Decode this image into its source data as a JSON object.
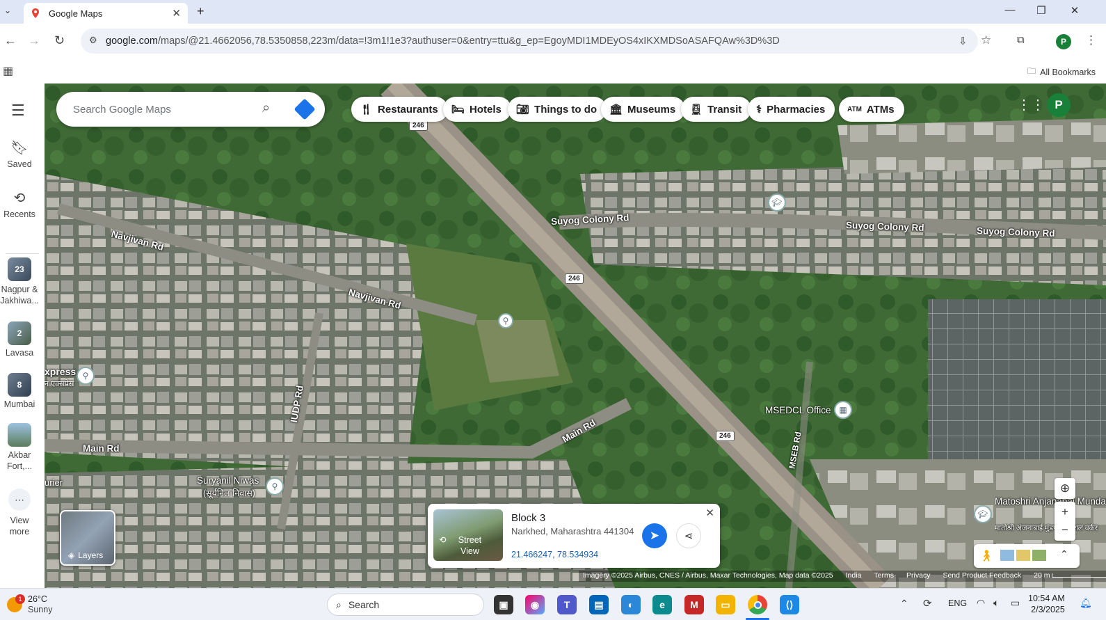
{
  "browser": {
    "tab_title": "Google Maps",
    "tab_close": "✕",
    "new_tab": "+",
    "url_host": "google.com",
    "url_path": "/maps/@21.4662056,78.5350858,223m/data=!3m1!1e3?authuser=0&entry=ttu&g_ep=EgoyMDI1MDEyOS4xIKXMDSoASAFQAw%3D%3D",
    "all_bookmarks": "All Bookmarks",
    "profile_initial": "P"
  },
  "rail": {
    "saved": "Saved",
    "recents": "Recents",
    "items": [
      {
        "count": "23",
        "label": "Nagpur & Jakhiwa..."
      },
      {
        "count": "2",
        "label": "Lavasa"
      },
      {
        "count": "8",
        "label": "Mumbai"
      },
      {
        "count": "",
        "label": "Akbar Fort,..."
      }
    ],
    "view_more": "View more"
  },
  "search": {
    "placeholder": "Search Google Maps"
  },
  "chips": [
    {
      "label": "Restaurants",
      "icon": "restaurant-icon"
    },
    {
      "label": "Hotels",
      "icon": "bed-icon"
    },
    {
      "label": "Things to do",
      "icon": "camera-icon"
    },
    {
      "label": "Museums",
      "icon": "museum-icon"
    },
    {
      "label": "Transit",
      "icon": "train-icon"
    },
    {
      "label": "Pharmacies",
      "icon": "pharmacy-icon"
    },
    {
      "label": "ATMs",
      "icon": "atm-icon"
    }
  ],
  "map_labels": {
    "suyog1": "Suyog Colony Rd",
    "suyog2": "Suyog Colony Rd",
    "suyog3": "Suyog Colony Rd",
    "navjivan1": "Navjivan Rd",
    "navjivan2": "Navjivan Rd",
    "main1": "Main Rd",
    "main2": "Main Rd",
    "iudp": "IUDP Rd",
    "mseb": "MSEB Rd",
    "express": "xpress",
    "express_sub": "न एक्सप्रेस",
    "urier": "urier",
    "suryanil": "Suryanil Niwas",
    "suryanil_sub": "(सूर्यनिल निवास)",
    "msedcl": "MSEDCL Office",
    "matoshri": "Matoshri Anjanabai Mundafale So",
    "matoshri_sub": "मातोश्री अंजनाबाई मुंडफळे सोशल वर्कर",
    "hw1": "246",
    "hw2": "246",
    "hw3": "246"
  },
  "card": {
    "title": "Block 3",
    "address": "Narkhed, Maharashtra 441304",
    "coords": "21.466247, 78.534934",
    "street_view": "Street View",
    "close": "✕"
  },
  "layers": "Layers",
  "attribution": {
    "imagery": "Imagery ©2025 Airbus, CNES / Airbus, Maxar Technologies, Map data ©2025",
    "india": "India",
    "terms": "Terms",
    "privacy": "Privacy",
    "feedback": "Send Product Feedback",
    "scale": "20 m"
  },
  "taskbar": {
    "weather_temp": "26°C",
    "weather_cond": "Sunny",
    "weather_badge": "1",
    "search": "Search",
    "lang": "ENG",
    "time": "10:54 AM",
    "date": "2/3/2025"
  }
}
